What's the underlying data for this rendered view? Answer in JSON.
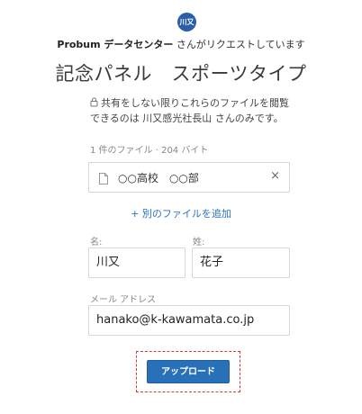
{
  "header": {
    "avatar_text": "川又",
    "requester_name": "Probum データセンター",
    "request_suffix": " さんがリクエストしています",
    "title": "記念パネル　スポーツタイプ"
  },
  "notice": {
    "icon": "lock-icon",
    "line1": "共有をしない限りこれらのファイルを閲覧",
    "line2": "できるのは 川又感光社長山 さんのみです。"
  },
  "files": {
    "count_text": "1 件のファイル · 204 バイト",
    "items": [
      {
        "name": "○○高校　○○部",
        "remove_label": "×"
      }
    ],
    "add_label": "+ 別のファイルを追加"
  },
  "form": {
    "first_name_label": "名:",
    "first_name_value": "川又",
    "last_name_label": "姓:",
    "last_name_value": "花子",
    "email_label": "メール アドレス",
    "email_value": "hanako@k-kawamata.co.jp"
  },
  "actions": {
    "upload_label": "アップロード"
  },
  "colors": {
    "accent": "#2870b8",
    "link": "#2a73c2",
    "avatar": "#2a5ea8",
    "focus_outline": "#d43a3a"
  }
}
